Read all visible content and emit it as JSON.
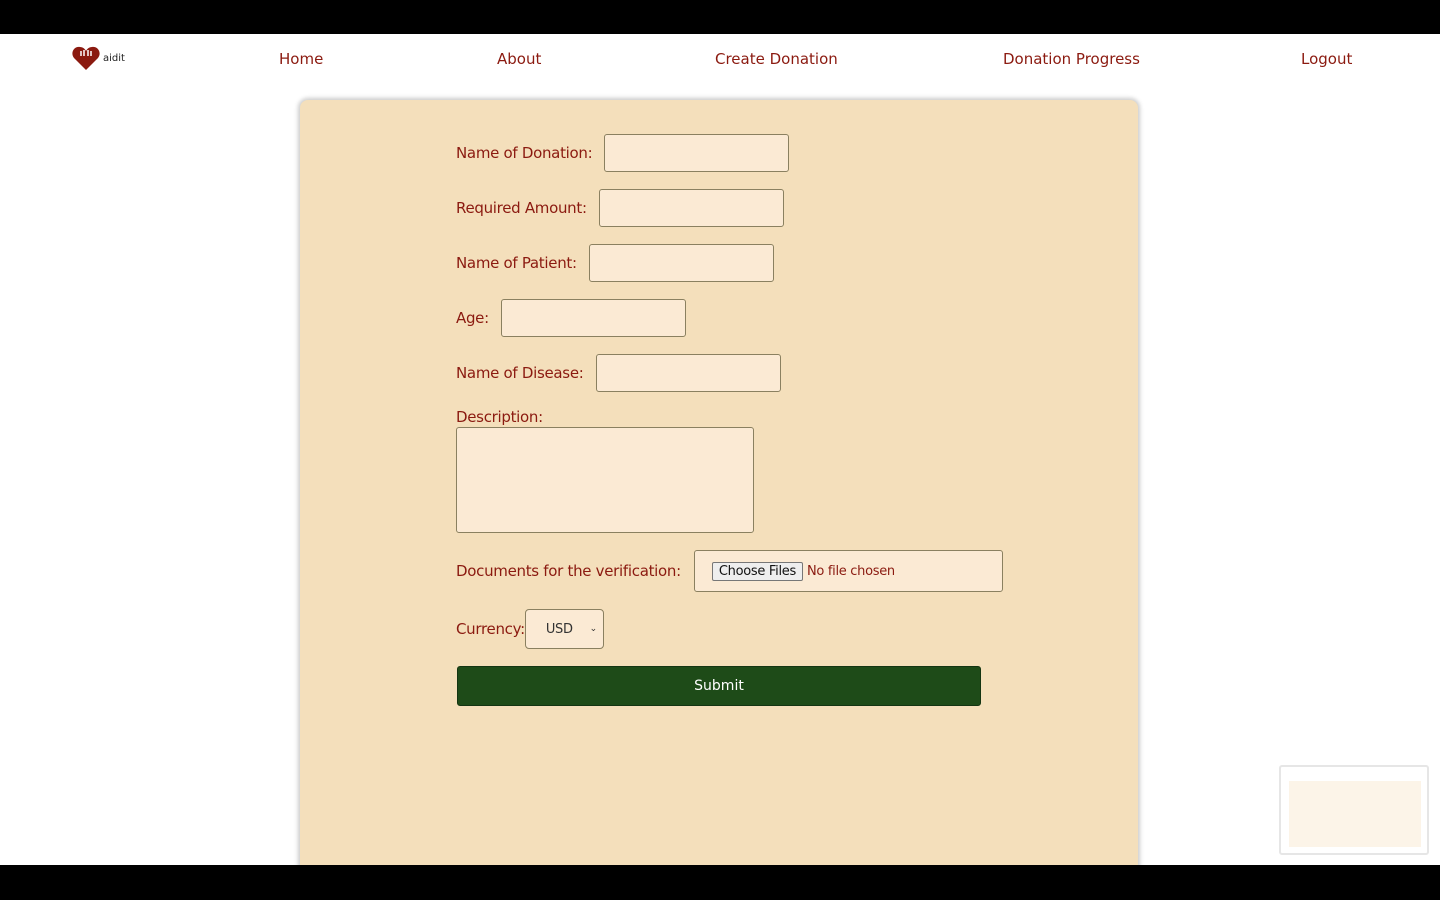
{
  "nav": {
    "logo_text": "aidit",
    "items": [
      "Home",
      "About",
      "Create Donation",
      "Donation Progress",
      "Logout"
    ]
  },
  "form": {
    "fields": [
      {
        "label": "Name of Donation:",
        "value": ""
      },
      {
        "label": "Required Amount:",
        "value": ""
      },
      {
        "label": "Name of Patient:",
        "value": ""
      },
      {
        "label": "Age:",
        "value": ""
      },
      {
        "label": "Name of Disease:",
        "value": ""
      }
    ],
    "description_label": "Description:",
    "documents_label": "Documents for the verification:",
    "choose_files": "Choose Files",
    "no_file": "No file chosen",
    "currency_label": "Currency:",
    "currency_value": "USD",
    "submit": "Submit"
  },
  "colors": {
    "accent": "#8b1a10",
    "card": "#f4dfbb",
    "submit": "#1e4b18"
  }
}
